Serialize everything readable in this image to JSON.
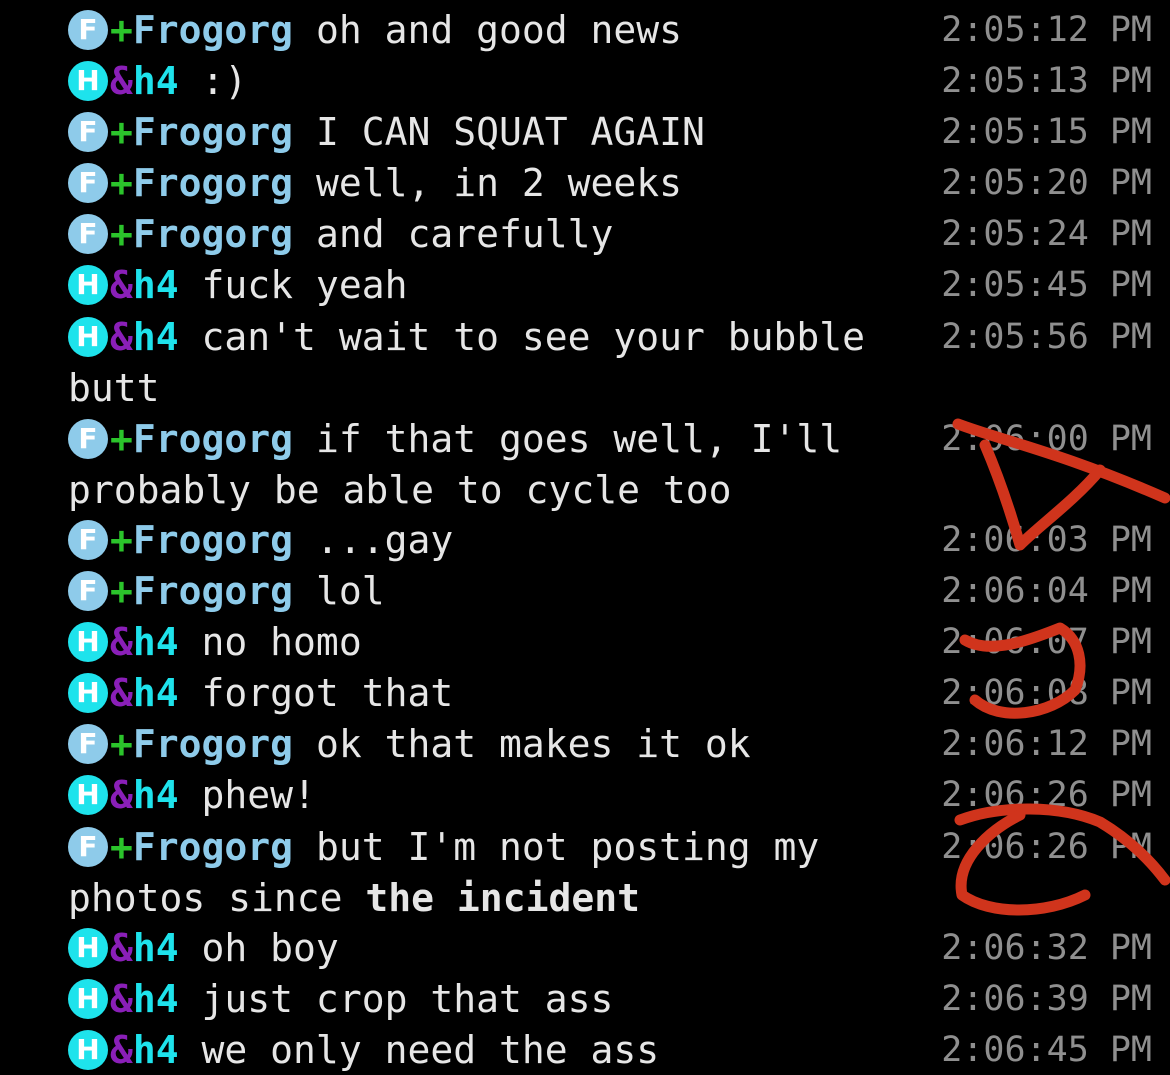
{
  "users": {
    "Frogorg": {
      "nick": "Frogorg",
      "avatar_letter": "F",
      "prefix": "+",
      "avatar_color": "#8ecbea",
      "prefix_color": "#2bc42b",
      "nick_color": "#8ecbea"
    },
    "h4": {
      "nick": "h4",
      "avatar_letter": "H",
      "prefix": "&",
      "avatar_color": "#1ee3ec",
      "prefix_color": "#8a1fb8",
      "nick_color": "#1ee3ec"
    }
  },
  "messages": [
    {
      "user": "Frogorg",
      "text": "oh and good news",
      "time": "2:05:12 PM"
    },
    {
      "user": "h4",
      "text": ":)",
      "time": "2:05:13 PM"
    },
    {
      "user": "Frogorg",
      "text": "I CAN SQUAT AGAIN",
      "time": "2:05:15 PM"
    },
    {
      "user": "Frogorg",
      "text": "well, in 2 weeks",
      "time": "2:05:20 PM"
    },
    {
      "user": "Frogorg",
      "text": "and carefully",
      "time": "2:05:24 PM"
    },
    {
      "user": "h4",
      "text": "fuck yeah",
      "time": "2:05:45 PM"
    },
    {
      "user": "h4",
      "text": "can't wait to see your bubble butt",
      "time": "2:05:56 PM"
    },
    {
      "user": "Frogorg",
      "text": "if that goes well, I'll probably be able to cycle too",
      "time": "2:06:00 PM"
    },
    {
      "user": "Frogorg",
      "text": "...gay",
      "time": "2:06:03 PM"
    },
    {
      "user": "Frogorg",
      "text": "lol",
      "time": "2:06:04 PM"
    },
    {
      "user": "h4",
      "text": "no homo",
      "time": "2:06:07 PM"
    },
    {
      "user": "h4",
      "text": "forgot that",
      "time": "2:06:08 PM"
    },
    {
      "user": "Frogorg",
      "text": "ok that makes it ok",
      "time": "2:06:12 PM"
    },
    {
      "user": "h4",
      "text": "phew!",
      "time": "2:06:26 PM"
    },
    {
      "user": "Frogorg",
      "text": "but I'm not posting my photos since ",
      "bold": "the incident",
      "time": "2:06:26 PM"
    },
    {
      "user": "h4",
      "text": "oh boy",
      "time": "2:06:32 PM"
    },
    {
      "user": "h4",
      "text": "just crop that ass",
      "time": "2:06:39 PM"
    },
    {
      "user": "h4",
      "text": "we only need the ass",
      "time": "2:06:45 PM"
    }
  ],
  "annotation_color": "#d0341c"
}
